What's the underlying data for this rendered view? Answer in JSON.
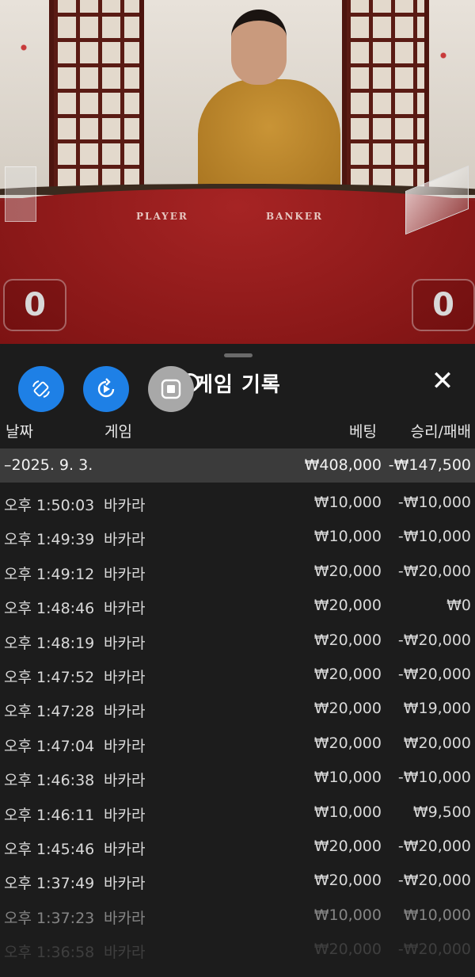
{
  "video": {
    "player_label": "PLAYER",
    "banker_label": "BANKER",
    "player_score": "0",
    "banker_score": "0"
  },
  "sheet": {
    "title": "게임 기록",
    "close_label": "✕",
    "columns": {
      "date": "날짜",
      "game": "게임",
      "bet": "베팅",
      "result": "승리/패배"
    },
    "summary": {
      "date": "–2025. 9. 3.",
      "bet": "₩408,000",
      "result": "-₩147,500"
    },
    "rows": [
      {
        "time": "오후 1:50:03",
        "game": "바카라",
        "bet": "₩10,000",
        "result": "-₩10,000"
      },
      {
        "time": "오후 1:49:39",
        "game": "바카라",
        "bet": "₩10,000",
        "result": "-₩10,000"
      },
      {
        "time": "오후 1:49:12",
        "game": "바카라",
        "bet": "₩20,000",
        "result": "-₩20,000"
      },
      {
        "time": "오후 1:48:46",
        "game": "바카라",
        "bet": "₩20,000",
        "result": "₩0"
      },
      {
        "time": "오후 1:48:19",
        "game": "바카라",
        "bet": "₩20,000",
        "result": "-₩20,000"
      },
      {
        "time": "오후 1:47:52",
        "game": "바카라",
        "bet": "₩20,000",
        "result": "-₩20,000"
      },
      {
        "time": "오후 1:47:28",
        "game": "바카라",
        "bet": "₩20,000",
        "result": "₩19,000"
      },
      {
        "time": "오후 1:47:04",
        "game": "바카라",
        "bet": "₩20,000",
        "result": "₩20,000"
      },
      {
        "time": "오후 1:46:38",
        "game": "바카라",
        "bet": "₩10,000",
        "result": "-₩10,000"
      },
      {
        "time": "오후 1:46:11",
        "game": "바카라",
        "bet": "₩10,000",
        "result": "₩9,500"
      },
      {
        "time": "오후 1:45:46",
        "game": "바카라",
        "bet": "₩20,000",
        "result": "-₩20,000"
      },
      {
        "time": "오후 1:37:49",
        "game": "바카라",
        "bet": "₩20,000",
        "result": "-₩20,000"
      },
      {
        "time": "오후 1:37:23",
        "game": "바카라",
        "bet": "₩10,000",
        "result": "₩10,000"
      },
      {
        "time": "오후 1:36:58",
        "game": "바카라",
        "bet": "₩20,000",
        "result": "-₩20,000"
      }
    ]
  },
  "toolbar": {
    "buttons": [
      {
        "icon": "rotate-screen-icon",
        "color": "#1e80e6"
      },
      {
        "icon": "replay-icon",
        "color": "#1e80e6"
      },
      {
        "icon": "stop-recording-icon",
        "color": "#a8a8a8"
      }
    ]
  }
}
